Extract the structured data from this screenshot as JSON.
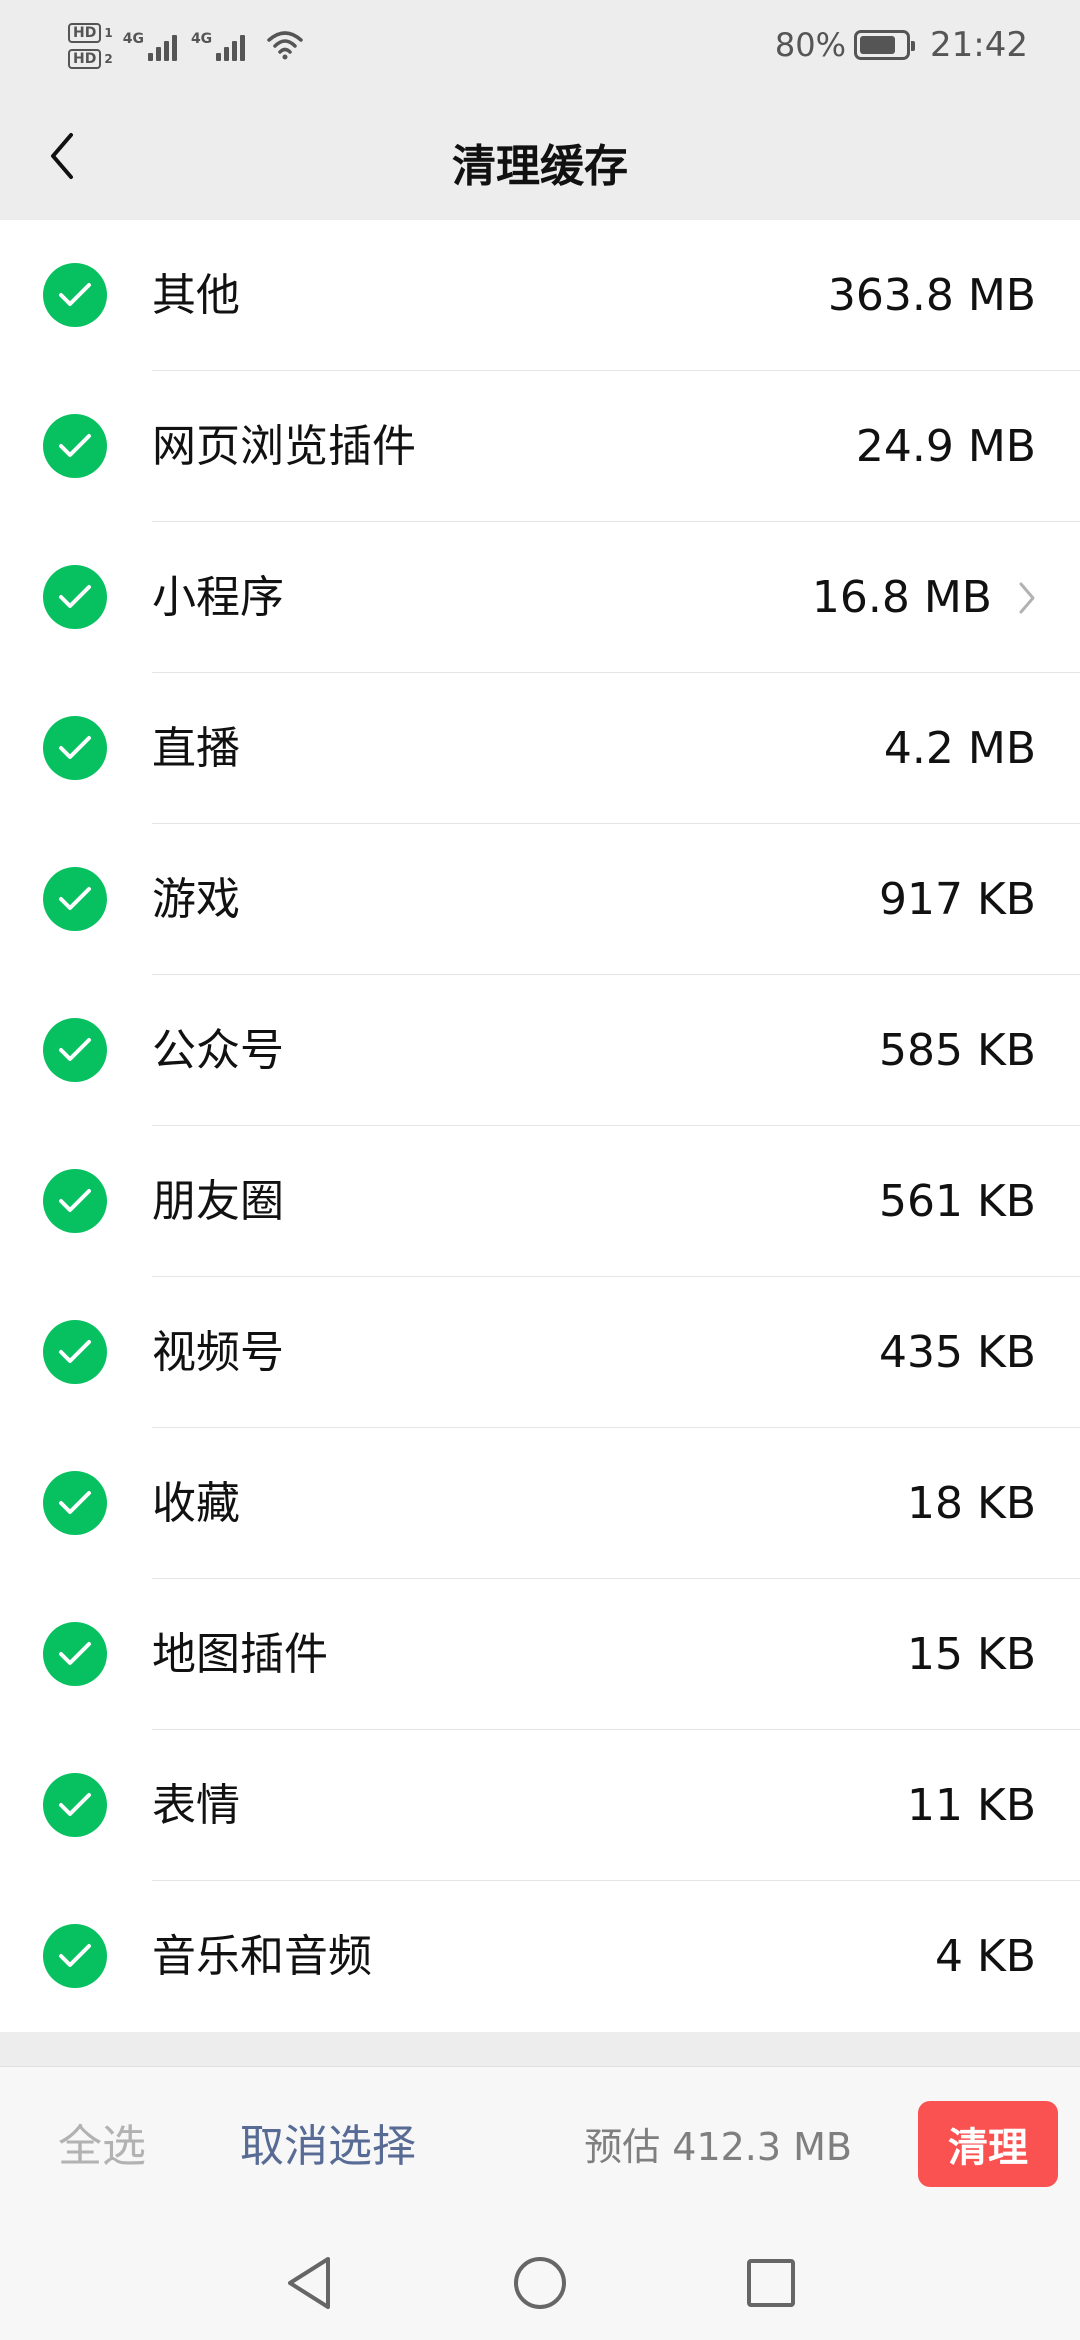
{
  "status_bar": {
    "sim1_label": "HD",
    "sim1_num": "1",
    "sim2_label": "HD",
    "sim2_num": "2",
    "net1": "4G",
    "net2": "4G",
    "battery_percent": "80%",
    "battery_level": 0.8,
    "time": "21:42"
  },
  "nav": {
    "title": "清理缓存",
    "back_icon": "chevron-left-icon"
  },
  "cache_items": [
    {
      "label": "其他",
      "size": "363.8 MB",
      "checked": true,
      "has_arrow": false
    },
    {
      "label": "网页浏览插件",
      "size": "24.9 MB",
      "checked": true,
      "has_arrow": false
    },
    {
      "label": "小程序",
      "size": "16.8 MB",
      "checked": true,
      "has_arrow": true
    },
    {
      "label": "直播",
      "size": "4.2 MB",
      "checked": true,
      "has_arrow": false
    },
    {
      "label": "游戏",
      "size": "917 KB",
      "checked": true,
      "has_arrow": false
    },
    {
      "label": "公众号",
      "size": "585 KB",
      "checked": true,
      "has_arrow": false
    },
    {
      "label": "朋友圈",
      "size": "561 KB",
      "checked": true,
      "has_arrow": false
    },
    {
      "label": "视频号",
      "size": "435 KB",
      "checked": true,
      "has_arrow": false
    },
    {
      "label": "收藏",
      "size": "18 KB",
      "checked": true,
      "has_arrow": false
    },
    {
      "label": "地图插件",
      "size": "15 KB",
      "checked": true,
      "has_arrow": false
    },
    {
      "label": "表情",
      "size": "11 KB",
      "checked": true,
      "has_arrow": false
    },
    {
      "label": "音乐和音频",
      "size": "4 KB",
      "checked": true,
      "has_arrow": false
    }
  ],
  "action_bar": {
    "select_all": "全选",
    "deselect": "取消选择",
    "estimate": "预估 412.3 MB",
    "clean": "清理"
  },
  "colors": {
    "accent_green": "#07c160",
    "danger_red": "#fa5151",
    "link_blue": "#576b95",
    "disabled_gray": "#b2b2b2"
  },
  "system_nav": {
    "back_icon": "triangle-back-icon",
    "home_icon": "circle-home-icon",
    "recents_icon": "square-recents-icon"
  }
}
